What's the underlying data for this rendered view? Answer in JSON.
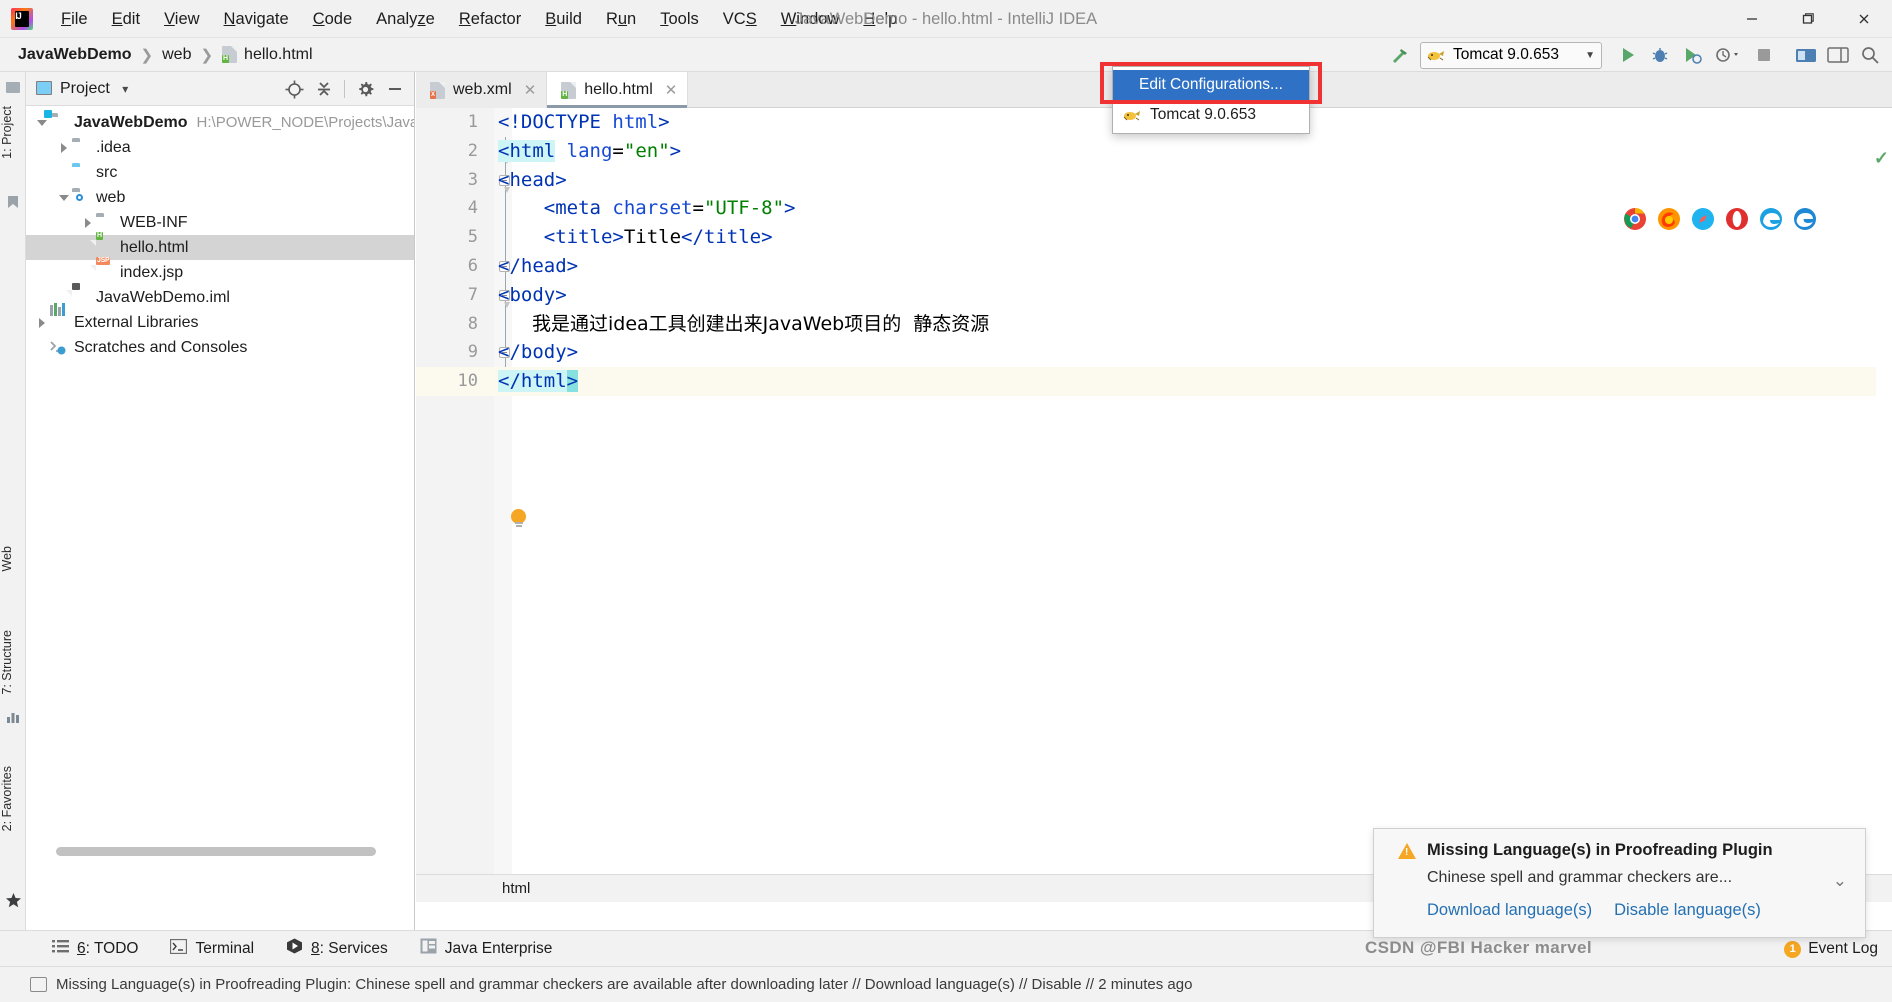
{
  "window": {
    "title": "JavaWebDemo - hello.html - IntelliJ IDEA",
    "minimize": "─",
    "maximize": "❐",
    "close": "✕",
    "logo_text": "IJ"
  },
  "menubar": {
    "items": [
      {
        "label": "File",
        "mnemonic": "F"
      },
      {
        "label": "Edit",
        "mnemonic": "E"
      },
      {
        "label": "View",
        "mnemonic": "V"
      },
      {
        "label": "Navigate",
        "mnemonic": "N"
      },
      {
        "label": "Code",
        "mnemonic": "C"
      },
      {
        "label": "Analyze",
        "mnemonic": "y"
      },
      {
        "label": "Refactor",
        "mnemonic": "R"
      },
      {
        "label": "Build",
        "mnemonic": "B"
      },
      {
        "label": "Run",
        "mnemonic": "u"
      },
      {
        "label": "Tools",
        "mnemonic": "T"
      },
      {
        "label": "VCS",
        "mnemonic": "S"
      },
      {
        "label": "Window",
        "mnemonic": "W"
      },
      {
        "label": "Help",
        "mnemonic": "H"
      }
    ]
  },
  "breadcrumb": {
    "separator": "❯",
    "items": [
      {
        "label": "JavaWebDemo"
      },
      {
        "label": "web"
      },
      {
        "label": "hello.html"
      }
    ]
  },
  "toolbar": {
    "run_config_name": "Tomcat 9.0.653",
    "dropdown_caret": "▼",
    "run_tooltip": "Run",
    "debug_tooltip": "Debug",
    "build_icon": "hammer-icon"
  },
  "run_config_dropdown": {
    "items": [
      {
        "label": "Edit Configurations...",
        "selected": true
      },
      {
        "label": "Tomcat 9.0.653",
        "selected": false
      }
    ]
  },
  "left_rail": {
    "items": [
      {
        "label": "1: Project"
      },
      {
        "label": "Web"
      },
      {
        "label": "7: Structure"
      },
      {
        "label": "2: Favorites"
      }
    ]
  },
  "project_panel": {
    "title": "Project",
    "caret": "▾",
    "tools": [
      {
        "name": "locate-icon"
      },
      {
        "name": "collapse-all-icon"
      },
      {
        "name": "settings-gear-icon"
      },
      {
        "name": "hide-icon"
      }
    ],
    "tree": [
      {
        "label": "JavaWebDemo",
        "path": "H:\\POWER_NODE\\Projects\\Java",
        "depth": 0,
        "twist": "down",
        "icon": "module-folder",
        "bold": true,
        "selected": false
      },
      {
        "label": ".idea",
        "path": "",
        "depth": 1,
        "twist": "right",
        "icon": "folder",
        "bold": false,
        "selected": false
      },
      {
        "label": "src",
        "path": "",
        "depth": 1,
        "twist": "none",
        "icon": "source-folder",
        "bold": false,
        "selected": false
      },
      {
        "label": "web",
        "path": "",
        "depth": 1,
        "twist": "down",
        "icon": "web-folder",
        "bold": false,
        "selected": false
      },
      {
        "label": "WEB-INF",
        "path": "",
        "depth": 2,
        "twist": "right",
        "icon": "folder",
        "bold": false,
        "selected": false
      },
      {
        "label": "hello.html",
        "path": "",
        "depth": 2,
        "twist": "none",
        "icon": "html-file",
        "bold": false,
        "selected": true
      },
      {
        "label": "index.jsp",
        "path": "",
        "depth": 2,
        "twist": "none",
        "icon": "jsp-file",
        "bold": false,
        "selected": false
      },
      {
        "label": "JavaWebDemo.iml",
        "path": "",
        "depth": 1,
        "twist": "none",
        "icon": "iml-file",
        "bold": false,
        "selected": false
      },
      {
        "label": "External Libraries",
        "path": "",
        "depth": 0,
        "twist": "right",
        "icon": "libraries",
        "bold": false,
        "selected": false
      },
      {
        "label": "Scratches and Consoles",
        "path": "",
        "depth": 0,
        "twist": "none",
        "icon": "scratches",
        "bold": false,
        "selected": false
      }
    ]
  },
  "editor": {
    "tabs": [
      {
        "label": "web.xml",
        "icon": "xml-file",
        "active": false,
        "close": "✕"
      },
      {
        "label": "hello.html",
        "icon": "html-file",
        "active": true,
        "close": "✕"
      }
    ],
    "breadcrumb_bottom": "html",
    "inspection_status": "✓",
    "lines": [
      {
        "no": "1",
        "current": false
      },
      {
        "no": "2",
        "current": false
      },
      {
        "no": "3",
        "current": false
      },
      {
        "no": "4",
        "current": false
      },
      {
        "no": "5",
        "current": false
      },
      {
        "no": "6",
        "current": false
      },
      {
        "no": "7",
        "current": false
      },
      {
        "no": "8",
        "current": false
      },
      {
        "no": "9",
        "current": false
      },
      {
        "no": "10",
        "current": true
      }
    ],
    "source_text": [
      "<!DOCTYPE html>",
      "<html lang=\"en\">",
      "<head>",
      "    <meta charset=\"UTF-8\">",
      "    <title>Title</title>",
      "</head>",
      "<body>",
      "    我是通过idea工具创建出来JavaWeb项目的  静态资源",
      "</body>",
      "</html>"
    ],
    "chinese_line": "我是通过idea工具创建出来JavaWeb项目的  静态资源"
  },
  "browser_bar": {
    "icons": [
      "chrome-icon",
      "firefox-icon",
      "safari-icon",
      "opera-icon",
      "edge-legacy-icon",
      "edge-icon"
    ]
  },
  "notification": {
    "title": "Missing Language(s) in Proofreading Plugin",
    "body": "Chinese spell and grammar checkers are...",
    "links": [
      "Download language(s)",
      "Disable language(s)"
    ],
    "collapse_caret": "⌄",
    "warn_glyph": "!"
  },
  "status_bar": {
    "items": [
      {
        "label": "6: TODO",
        "mnemonic": "6",
        "icon": "todo-icon"
      },
      {
        "label": "Terminal",
        "mnemonic": "",
        "icon": "terminal-icon"
      },
      {
        "label": "8: Services",
        "mnemonic": "8",
        "icon": "services-icon"
      },
      {
        "label": "Java Enterprise",
        "mnemonic": "",
        "icon": "java-enterprise-icon"
      }
    ],
    "event_log": "Event Log",
    "event_badge": "1"
  },
  "bottom_message": "Missing Language(s) in Proofreading Plugin: Chinese spell and grammar checkers are available after downloading later // Download language(s) // Disable // 2 minutes ago",
  "watermark": "CSDN @FBI Hacker marvel",
  "colors": {
    "accent_blue": "#2f72c5",
    "annotation_red": "#f03232",
    "tag_blue": "#0033b3",
    "string_green": "#008000",
    "selection_cyan": "#cdf5f5",
    "current_line": "#fcfaef",
    "ok_green": "#59a869",
    "warn_orange": "#f5a623"
  }
}
